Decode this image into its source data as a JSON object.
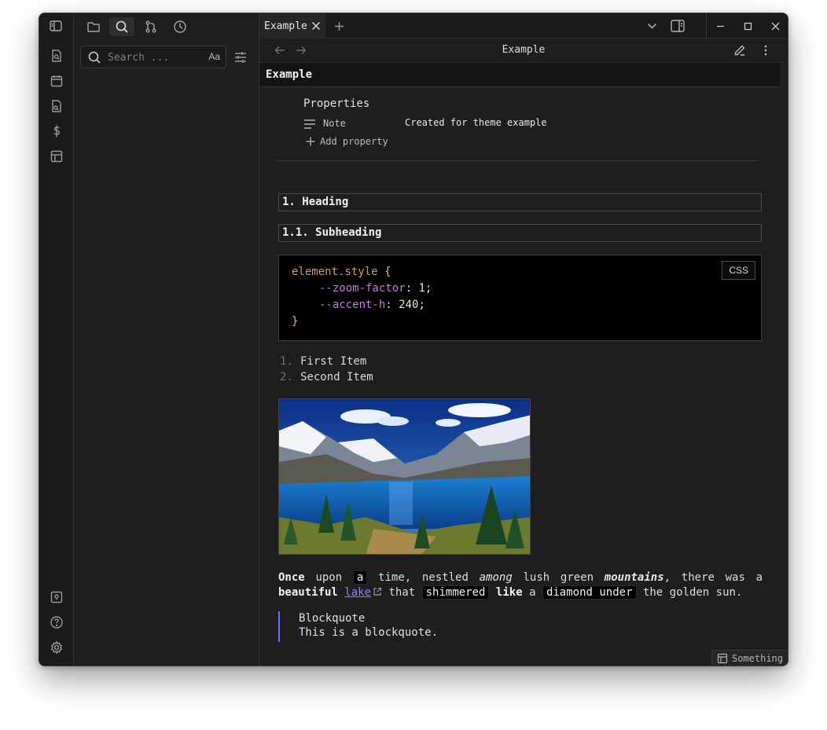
{
  "sidebar": {
    "search": {
      "placeholder": "Search ...",
      "match_case_label": "Aa"
    }
  },
  "tabs": [
    {
      "label": "Example"
    }
  ],
  "view_header": {
    "title": "Example"
  },
  "note": {
    "inline_title": "Example",
    "properties": {
      "heading": "Properties",
      "items": [
        {
          "key": "Note",
          "value": "Created for theme example"
        }
      ],
      "add_label": "Add property"
    },
    "heading1": "1. Heading",
    "heading2": "1.1. Subheading",
    "code": {
      "language": "CSS",
      "selector": "element.style",
      "open_brace": "{",
      "close_brace": "}",
      "declarations": [
        {
          "prop": "--zoom-factor",
          "value": "1"
        },
        {
          "prop": "--accent-h",
          "value": "240"
        }
      ]
    },
    "list": [
      {
        "num": "1.",
        "text": "First Item"
      },
      {
        "num": "2.",
        "text": "Second Item"
      }
    ],
    "paragraph": {
      "w_once": "Once",
      "t_upon": "upon",
      "w_a1": "a",
      "t_time": "time, nestled",
      "w_among": "among",
      "t_lush": "lush green",
      "w_mountains": "mountains",
      "t_there": ", there was a",
      "w_beautiful": "beautiful",
      "w_lake": "lake",
      "t_that": "that",
      "w_shimmered": "shimmered",
      "w_like": "like",
      "t_a2": "a",
      "w_diamond": "diamond under",
      "t_sun": "the golden sun."
    },
    "blockquote": {
      "line1": "Blockquote",
      "line2": "This is a blockquote."
    }
  },
  "status_bar": {
    "label": "Something"
  },
  "colors": {
    "accent": "#6c6cff",
    "link": "#8f84ff",
    "background": "#1e1e1e"
  }
}
